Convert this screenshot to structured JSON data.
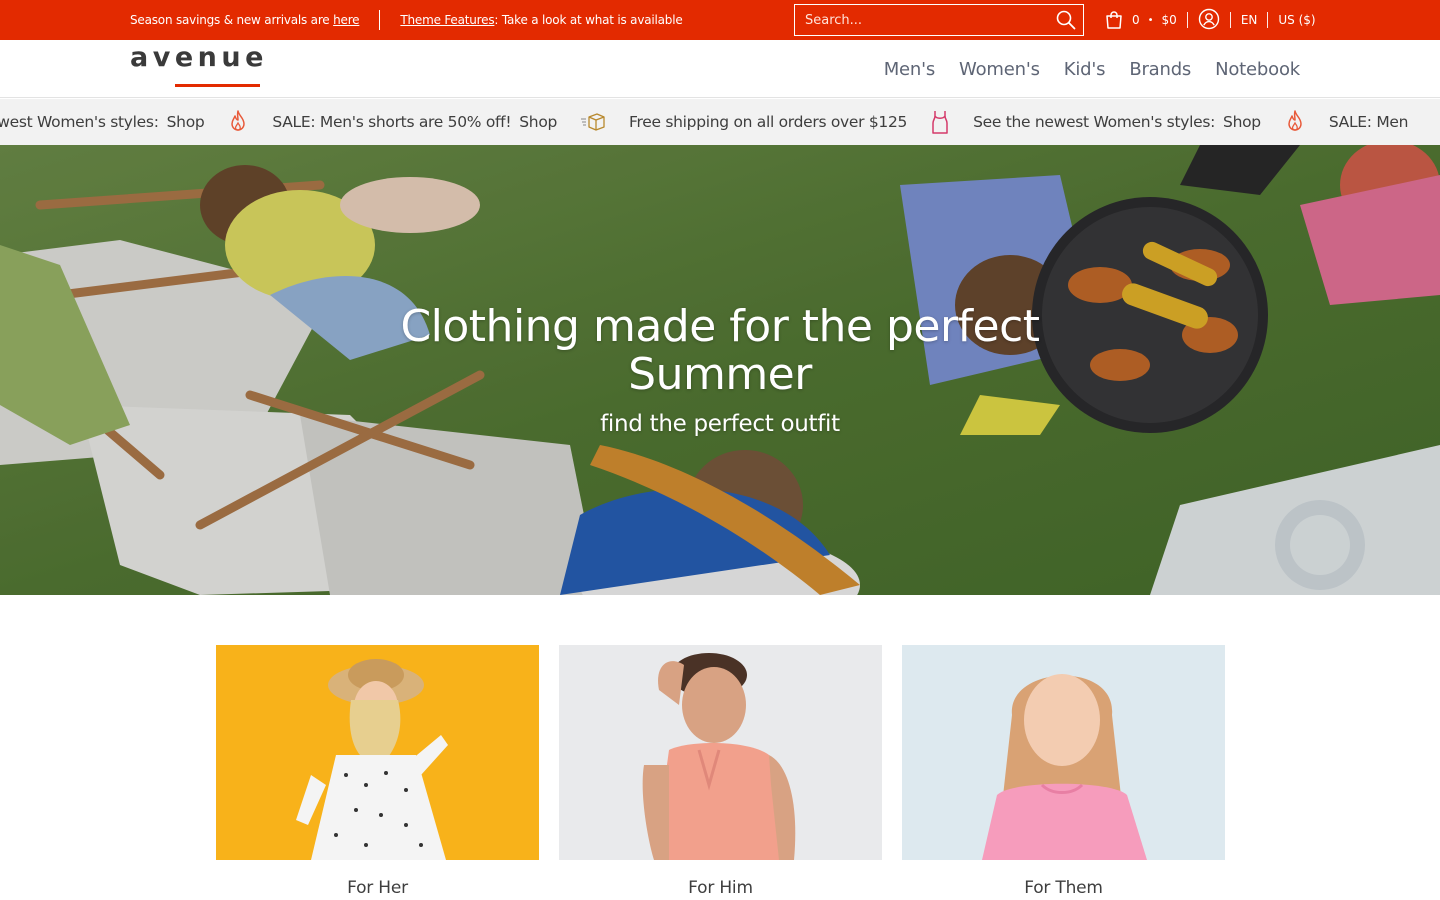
{
  "topbar": {
    "promo_text": "Season savings & new arrivals are ",
    "promo_link": "here",
    "features_link": "Theme Features",
    "features_text": ": Take a look at what is available",
    "search_placeholder": "Search...",
    "cart_count": "0",
    "cart_separator": "•",
    "cart_total": "$0",
    "language": "EN",
    "currency": "US ($)"
  },
  "header": {
    "logo_text": "avenue",
    "nav": [
      {
        "label": "Men's"
      },
      {
        "label": "Women's"
      },
      {
        "label": "Kid's"
      },
      {
        "label": "Brands"
      },
      {
        "label": "Notebook"
      }
    ]
  },
  "ticker": {
    "items": [
      {
        "text": "ewest Women's styles:",
        "link": "Shop",
        "icon": "fire-icon"
      },
      {
        "text": "SALE: Men's shorts are 50% off!",
        "link": "Shop",
        "icon": "shipping-box-icon"
      },
      {
        "text": "Free shipping on all orders over $125",
        "link": "",
        "icon": "tank-top-icon"
      },
      {
        "text": "See the newest Women's styles:",
        "link": "Shop",
        "icon": "fire-icon"
      },
      {
        "text": "SALE: Men",
        "link": "",
        "icon": ""
      }
    ]
  },
  "hero": {
    "title": "Clothing made for the perfect Summer",
    "subtitle": "find the perfect outfit"
  },
  "collections": [
    {
      "label": "For Her",
      "image": "woman-in-straw-hat-photo"
    },
    {
      "label": "For Him",
      "image": "man-in-tank-top-photo"
    },
    {
      "label": "For Them",
      "image": "girl-in-pink-shirt-photo"
    }
  ],
  "colors": {
    "accent": "#e32a00",
    "ticker_bg": "#f2f2f2",
    "nav_text": "#5e6575"
  }
}
